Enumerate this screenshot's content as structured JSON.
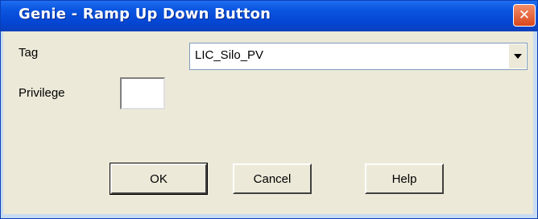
{
  "window": {
    "title": "Genie - Ramp Up Down Button",
    "close_glyph": "✕"
  },
  "form": {
    "tag_label": "Tag",
    "tag_value": "LIC_Silo_PV",
    "privilege_label": "Privilege",
    "privilege_value": ""
  },
  "buttons": {
    "ok_label": "OK",
    "cancel_label": "Cancel",
    "help_label": "Help"
  },
  "icons": {
    "close": "close-icon",
    "dropdown": "chevron-down-icon"
  },
  "colors": {
    "titlebar": "#0546d4",
    "close_button": "#d9461c",
    "dialog_background": "#ece9d8"
  }
}
